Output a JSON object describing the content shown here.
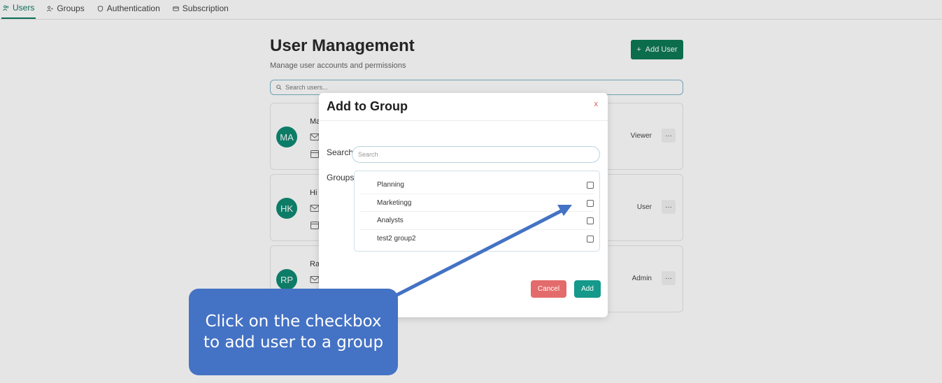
{
  "nav": {
    "tabs": [
      {
        "label": "Users",
        "icon": "users-icon",
        "active": true
      },
      {
        "label": "Groups",
        "icon": "groups-icon",
        "active": false
      },
      {
        "label": "Authentication",
        "icon": "shield-icon",
        "active": false
      },
      {
        "label": "Subscription",
        "icon": "card-icon",
        "active": false
      }
    ]
  },
  "page": {
    "title": "User Management",
    "subtitle": "Manage user accounts and permissions",
    "add_user_label": "Add User",
    "search_placeholder": "Search users..."
  },
  "users": [
    {
      "initials": "MA",
      "name_visible": "Ma",
      "role": "Viewer"
    },
    {
      "initials": "HK",
      "name_visible": "Hi",
      "role": "User"
    },
    {
      "initials": "RP",
      "name_visible": "Ra",
      "role": "Admin"
    }
  ],
  "modal": {
    "title": "Add to Group",
    "close_label": "x",
    "search_label": "Search",
    "search_placeholder": "Search",
    "groups_label": "Groups",
    "groups": [
      {
        "name": "Planning",
        "checked": false
      },
      {
        "name": "Marketingg",
        "checked": false
      },
      {
        "name": "Analysts",
        "checked": false
      },
      {
        "name": "test2 group2",
        "checked": false
      }
    ],
    "cancel_label": "Cancel",
    "add_label": "Add"
  },
  "annotation": {
    "text": "Click on the checkbox to add user to a group",
    "color": "#4472c4"
  },
  "colors": {
    "accent": "#0f7a63",
    "add_user": "#0e7a55",
    "avatar": "#0f8b73",
    "cancel": "#e46b6b",
    "add": "#14998a"
  }
}
